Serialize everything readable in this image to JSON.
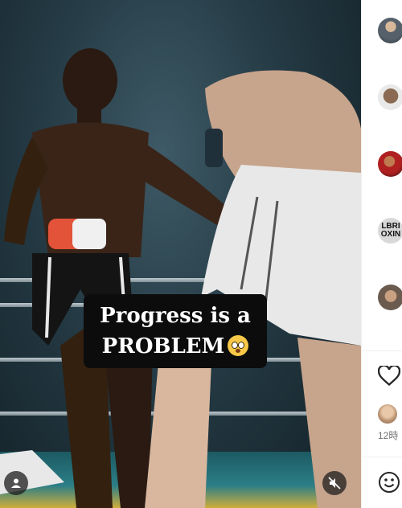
{
  "video": {
    "caption": {
      "line1": "Progress is a",
      "line2": "PROBLEM",
      "emoji": "flushed-face-emoji"
    },
    "controls": {
      "profile_icon": "user-icon",
      "mute_icon": "muted-speaker-icon"
    }
  },
  "sidebar": {
    "avatars": [
      "avatar-fighter-photo",
      "avatar-bald-man",
      "avatar-boxer-red",
      "avatar-logo",
      "avatar-fighter-portrait"
    ],
    "logo_text": "LBRI\nOXIN",
    "like_icon": "heart-icon",
    "timestamp": "12時",
    "comment_icon": "smiley-icon"
  },
  "colors": {
    "caption_bg": "#0c0c0c",
    "glove_red": "#e2533a",
    "shorts_white": "#e8e8e8",
    "ring_floor": "#2c7e86"
  }
}
